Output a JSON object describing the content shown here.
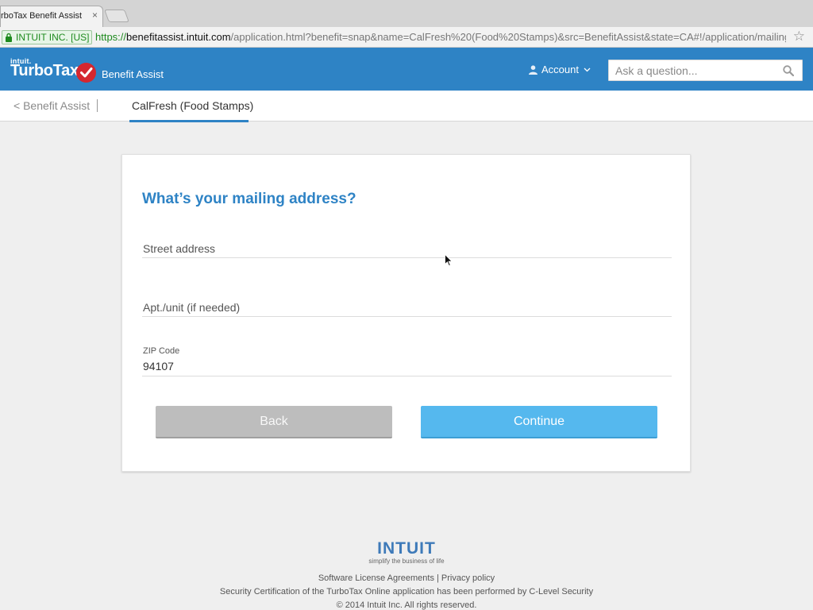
{
  "browser": {
    "tab_title": "rboTax Benefit Assist",
    "tab_close": "×",
    "ev_label": "INTUIT INC. [US]",
    "url_scheme": "https://",
    "url_host": "benefitassist.intuit.com",
    "url_path": "/application.html?benefit=snap&name=CalFresh%20(Food%20Stamps)&src=BenefitAssist&state=CA#!/application/mailingaddr…",
    "bookmark_icon": "star-icon"
  },
  "header": {
    "brand_small": "intuit.",
    "brand_main": "TurboTax",
    "brand_sub": "Benefit Assist",
    "account_label": "Account",
    "search_placeholder": "Ask a question...",
    "brand_color": "#2e83c5"
  },
  "subnav": {
    "back_label": "< Benefit Assist",
    "active_tab": "CalFresh (Food Stamps)"
  },
  "form": {
    "title": "What’s your mailing address?",
    "street_placeholder": "Street address",
    "apt_placeholder": "Apt./unit (if needed)",
    "zip_label": "ZIP Code",
    "zip_value": "94107",
    "back_button": "Back",
    "continue_button": "Continue",
    "continue_color": "#55b8ee"
  },
  "footer": {
    "logo": "INTUIT",
    "tagline": "simplify the business of life",
    "links_line": "Software License Agreements | Privacy policy",
    "certification": "Security Certification of the TurboTax Online application has been performed by C-Level Security",
    "copyright": "© 2014 Intuit Inc. All rights reserved."
  }
}
